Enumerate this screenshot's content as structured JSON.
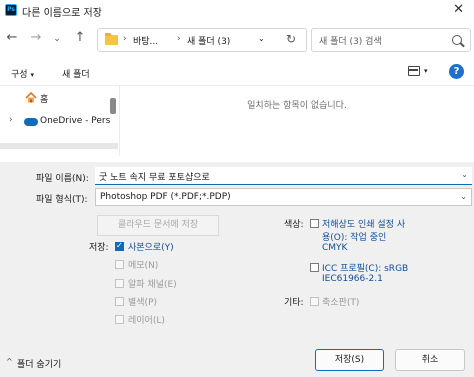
{
  "window": {
    "title": "다른 이름으로 저장",
    "app_icon_text": "Ps"
  },
  "nav": {
    "back": "←",
    "forward": "→",
    "history": "⌄",
    "up": "↑",
    "breadcrumb": [
      "바탕...",
      "새 폴더 (3)"
    ],
    "dropdown": "⌄",
    "refresh": "↻",
    "search_placeholder": "새 폴더 (3) 검색"
  },
  "toolbar": {
    "organize": "구성",
    "organize_arrow": "▾",
    "new_folder": "새 폴더",
    "view_arrow": "▾",
    "help": "?"
  },
  "navpane": {
    "items": [
      {
        "label": "홈"
      },
      {
        "label": "OneDrive - Pers"
      }
    ],
    "expand": "›"
  },
  "content": {
    "empty_message": "일치하는 항목이 없습니다."
  },
  "form": {
    "filename_label": "파일 이름(N):",
    "filename_value": "굿 노트 속지 무료 포토샵으로",
    "filetype_label": "파일 형식(T):",
    "filetype_value": "Photoshop PDF (*.PDF;*.PDP)",
    "cloud_button": "클라우드 문서에 저장",
    "save_label": "저장:",
    "save_options": [
      {
        "label": "사본으로(Y)",
        "checked": true,
        "enabled": true
      },
      {
        "label": "메모(N)",
        "checked": false,
        "enabled": false
      },
      {
        "label": "알파 채널(E)",
        "checked": false,
        "enabled": false
      },
      {
        "label": "별색(P)",
        "checked": false,
        "enabled": false
      },
      {
        "label": "레이어(L)",
        "checked": false,
        "enabled": false
      }
    ],
    "color_label": "색상:",
    "color_options": [
      {
        "line1": "저해상도 인쇄 설정 사",
        "line2": "용(O):  작업 중인",
        "line3": "CMYK",
        "checked": false
      },
      {
        "line1": "ICC 프로필(C):  sRGB",
        "line2": "IEC61966-2.1",
        "checked": false
      }
    ],
    "other_label": "기타:",
    "other_options": [
      {
        "label": "축소판(T)",
        "checked": false,
        "enabled": false
      }
    ]
  },
  "footer": {
    "hide_folders": "폴더 숨기기",
    "hide_arrow": "^",
    "save_button": "저장(S)",
    "cancel_button": "취소"
  }
}
